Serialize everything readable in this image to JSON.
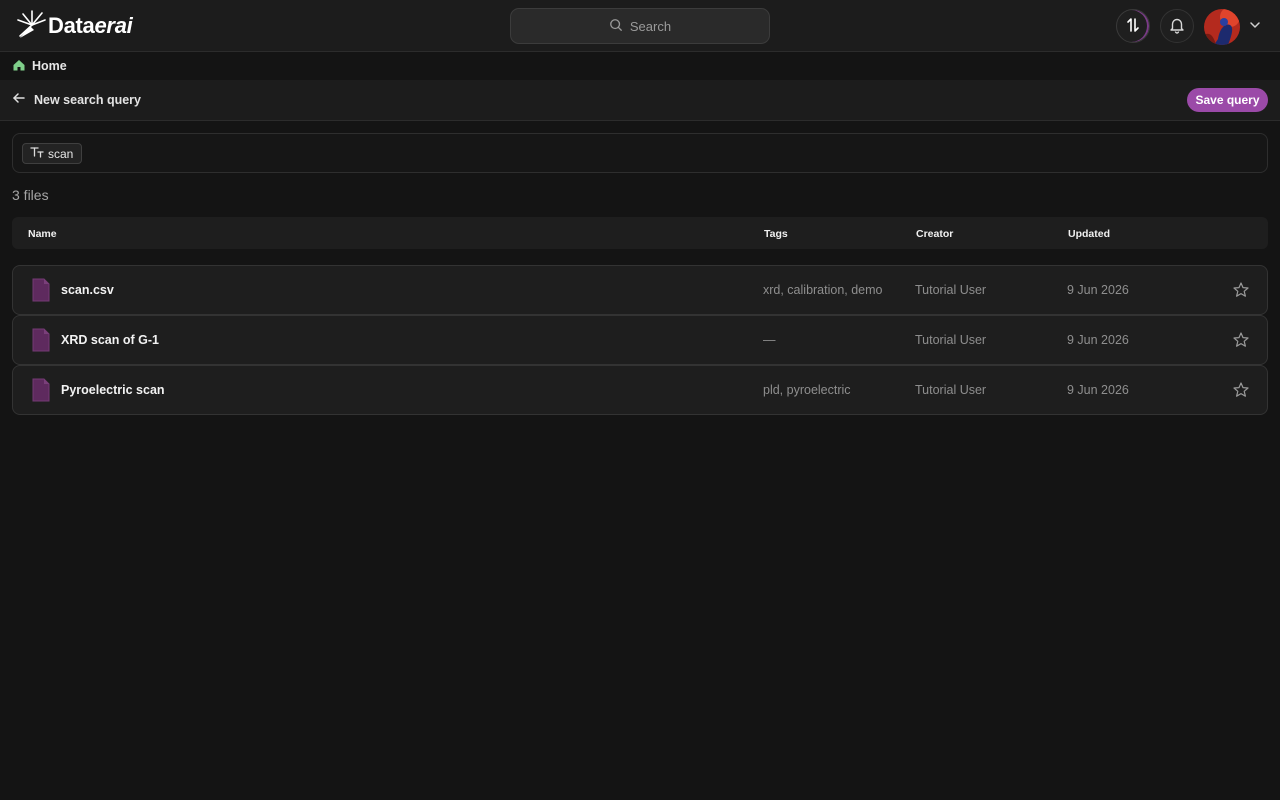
{
  "app": {
    "brand_prefix": "Data",
    "brand_suffix": "erai",
    "logo_icon": "spark-logo-icon"
  },
  "topbar": {
    "search_placeholder": "Search",
    "icons": [
      "search-icon",
      "sync-icon",
      "bell-icon",
      "avatar",
      "chevron-down-icon"
    ]
  },
  "breadcrumb": {
    "home_label": "Home",
    "home_icon_color": "#7fcf8a"
  },
  "query": {
    "title": "New search query",
    "save_label": "Save query"
  },
  "filter": {
    "chip_label": "scan"
  },
  "results": {
    "count_label": "3 files",
    "columns": [
      "Name",
      "Tags",
      "Creator",
      "Updated"
    ],
    "rows": [
      {
        "name": "scan.csv",
        "tags": "xrd, calibration, demo",
        "creator": "Tutorial User",
        "updated": "9 Jun 2026",
        "starred": false
      },
      {
        "name": "XRD scan of G-1",
        "tags": "—",
        "creator": "Tutorial User",
        "updated": "9 Jun 2026",
        "starred": false
      },
      {
        "name": "Pyroelectric scan",
        "tags": "pld, pyroelectric",
        "creator": "Tutorial User",
        "updated": "9 Jun 2026",
        "starred": false
      }
    ]
  },
  "colors": {
    "accent": "#9b4aa8",
    "file_icon": "#5e2a5e",
    "background": "#141414",
    "panel": "#1c1c1c"
  }
}
